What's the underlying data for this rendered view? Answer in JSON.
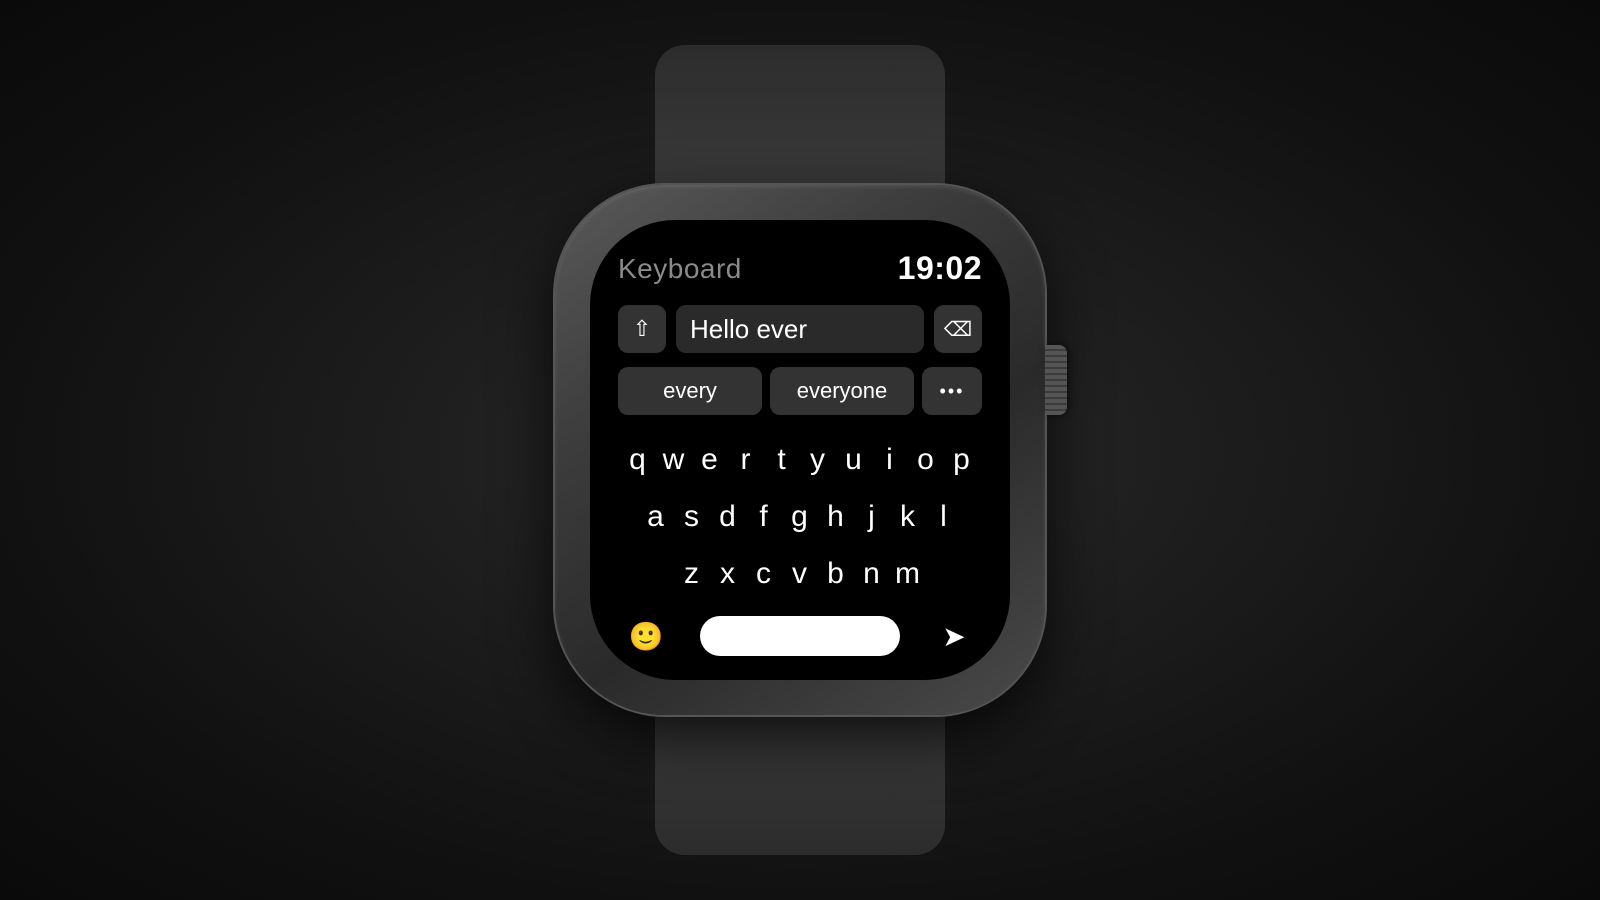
{
  "background": "#1a1a1a",
  "watch": {
    "screen": {
      "title": "Keyboard",
      "time": "19:02",
      "input_value": "Hello ever",
      "autocomplete": {
        "option1": "every",
        "option2": "everyone",
        "option3": "•••"
      },
      "keyboard": {
        "row1": [
          "q",
          "w",
          "e",
          "r",
          "t",
          "y",
          "u",
          "i",
          "o",
          "p"
        ],
        "row2": [
          "a",
          "s",
          "d",
          "f",
          "g",
          "h",
          "j",
          "k",
          "l"
        ],
        "row3": [
          "z",
          "x",
          "c",
          "v",
          "b",
          "n",
          "m"
        ]
      },
      "buttons": {
        "shift": "⇧",
        "delete": "⌫",
        "emoji": "🙂",
        "send": "➤",
        "more": "•••"
      }
    }
  }
}
